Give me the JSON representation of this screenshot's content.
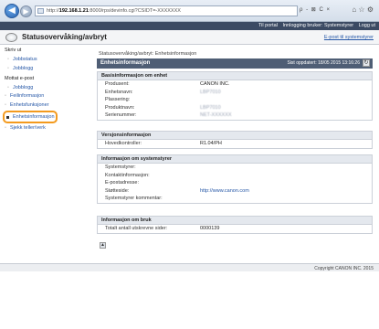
{
  "browser": {
    "address_ip": "192.168.1.21",
    "address_rest": ":8000/rps/devinfo.cgi?CSIDT=-XXXXXXX",
    "addr_icons": "ρ - ⊠ C ×",
    "tools": "⌂ ☆ ⚙"
  },
  "topbar": {
    "portal_link": "Til portal",
    "login_user": "Innlogging bruker: Systemstyrer",
    "logout_link": "Logg ut"
  },
  "titlebar": {
    "title": "Statusovervåking/avbryt",
    "mail_link": "E-post til systemstyrer"
  },
  "sidebar": {
    "group_print": "Skriv ut",
    "job_status": "Jobbstatus",
    "job_log": "Jobblogg",
    "group_email": "Mottat e-post",
    "email_job_log": "Jobblogg",
    "error_info": "Feilinformasjon",
    "consumables": "Enhetsfunksjoner",
    "device_info": "Enhetsinformasjon",
    "check_counter": "Sjekk teller/verk"
  },
  "main": {
    "breadcrumb": "Statusovervåking/avbryt: Enhetsinformasjon",
    "page_title": "Enhetsinformasjon",
    "last_updated": "Sist oppdatert: 18/05 2015 13:16:26",
    "refresh_icon": "↻"
  },
  "sections": {
    "basic": {
      "header": "Basisinformasjon om enhet",
      "rows": [
        {
          "label": "Produsent:",
          "value": "CANON INC."
        },
        {
          "label": "Enhetsnavn:",
          "value": "LBP7010"
        },
        {
          "label": "Plassering:",
          "value": ""
        },
        {
          "label": "Produktnavn:",
          "value": "LBP7010"
        },
        {
          "label": "Serienummer:",
          "value": "NET-XXXXXX"
        }
      ]
    },
    "version": {
      "header": "Versjonsinformasjon",
      "rows": [
        {
          "label": "Hovedkontroller:",
          "value": "R1.04/PH"
        }
      ]
    },
    "admin": {
      "header": "Informasjon om systemstyrer",
      "rows": [
        {
          "label": "Systemstyrer:",
          "value": ""
        },
        {
          "label": "Kontaktinformasjon:",
          "value": ""
        },
        {
          "label": "E-postadresse:",
          "value": ""
        },
        {
          "label": "Støtteside:",
          "value": "http://www.canon.com"
        },
        {
          "label": "Systemstyrer kommentar:",
          "value": ""
        }
      ]
    },
    "usage": {
      "header": "Informasjon om bruk",
      "rows": [
        {
          "label": "Totalt antall utskrevne sider:",
          "value": "0000139"
        }
      ]
    }
  },
  "footer": {
    "top_btn": "▲",
    "copyright": "Copyright CANON INC. 2015"
  }
}
